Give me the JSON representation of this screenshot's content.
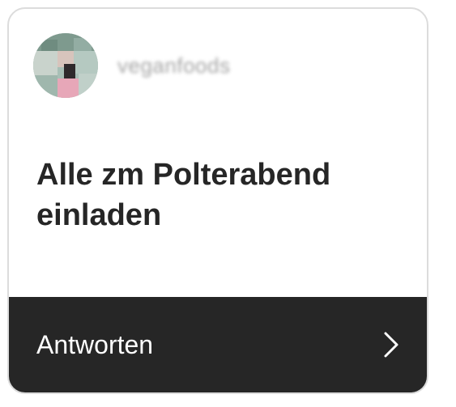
{
  "card": {
    "username": "veganfoods",
    "question": "Alle zm Polterabend einladen",
    "reply_label": "Antworten",
    "reply_icon": "chevron-right-icon"
  },
  "colors": {
    "footer_bg": "#262626",
    "footer_text": "#ffffff",
    "question_text": "#262626",
    "card_border": "#dcdcdc"
  }
}
